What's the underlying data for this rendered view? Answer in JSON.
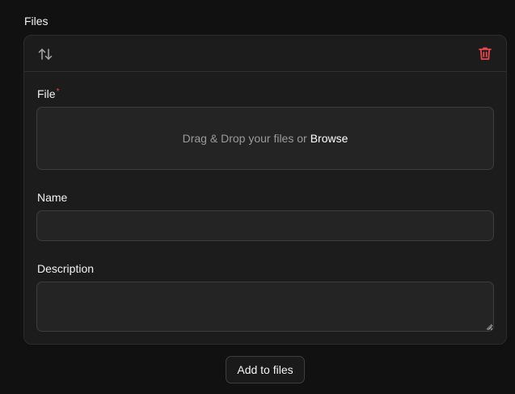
{
  "section": {
    "title": "Files"
  },
  "file_item": {
    "file_field": {
      "label": "File",
      "required_marker": "*",
      "dropzone_text": "Drag & Drop your files or",
      "browse_label": "Browse"
    },
    "name_field": {
      "label": "Name",
      "value": ""
    },
    "description_field": {
      "label": "Description",
      "value": ""
    },
    "icons": {
      "reorder": "arrow-up-down-icon",
      "delete": "trash-icon"
    }
  },
  "actions": {
    "add_label": "Add to files"
  },
  "colors": {
    "background": "#111111",
    "card": "#1c1c1c",
    "input": "#242424",
    "border": "#3c3c3c",
    "danger": "#e5484d",
    "muted_text": "#9a9a9a"
  }
}
